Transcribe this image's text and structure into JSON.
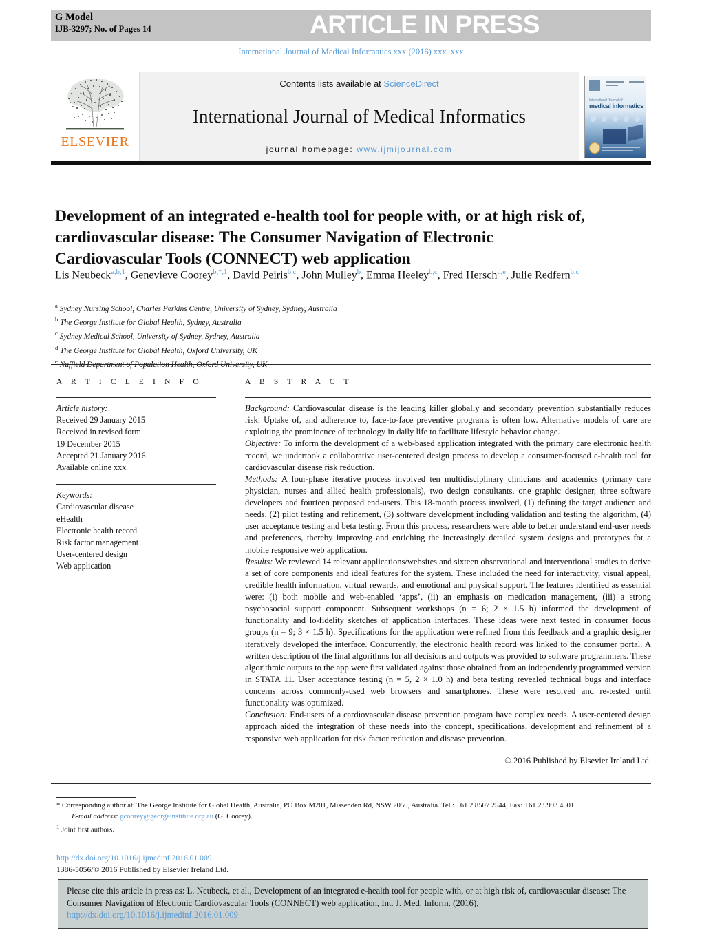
{
  "header": {
    "g_model": "G Model",
    "manuscript_id": "IJB-3297;   No. of Pages 14",
    "article_in_press": "ARTICLE IN PRESS",
    "runhead": "International Journal of Medical Informatics xxx (2016) xxx–xxx"
  },
  "masthead": {
    "publisher": "ELSEVIER",
    "contents_prefix": "Contents lists available at ",
    "contents_link": "ScienceDirect",
    "journal_name": "International Journal of Medical Informatics",
    "homepage_label": "journal homepage: ",
    "homepage_url": "www.ijmijournal.com",
    "cover_title_pre": "International Journal of",
    "cover_title_main": "medical informatics"
  },
  "article": {
    "title": "Development of an integrated e-health tool for people with, or at high risk of, cardiovascular disease: The Consumer Navigation of Electronic Cardiovascular Tools (CONNECT) web application",
    "authors": [
      {
        "name": "Lis Neubeck",
        "marks": "a,b,1",
        "sep": ", "
      },
      {
        "name": "Genevieve Coorey",
        "marks": "b,*,1",
        "sep": ", "
      },
      {
        "name": "David Peiris",
        "marks": "b,c",
        "sep": ", "
      },
      {
        "name": "John Mulley",
        "marks": "b",
        "sep": ", "
      },
      {
        "name": "Emma Heeley",
        "marks": "b,c",
        "sep": ", "
      },
      {
        "name": "Fred Hersch",
        "marks": "d,e",
        "sep": ", "
      },
      {
        "name": "Julie Redfern",
        "marks": "b,c",
        "sep": ""
      }
    ],
    "affiliations": [
      {
        "mark": "a",
        "text": "Sydney Nursing School, Charles Perkins Centre, University of Sydney, Sydney, Australia"
      },
      {
        "mark": "b",
        "text": "The George Institute for Global Health, Sydney, Australia"
      },
      {
        "mark": "c",
        "text": "Sydney Medical School, University of Sydney, Sydney, Australia"
      },
      {
        "mark": "d",
        "text": "The George Institute for Global Health, Oxford University, UK"
      },
      {
        "mark": "e",
        "text": "Nuffield Department of Population Health, Oxford University, UK"
      }
    ]
  },
  "article_info": {
    "heading": "A R T I C L E   I N F O",
    "history_label": "Article history:",
    "history": [
      "Received 29 January 2015",
      "Received in revised form",
      "19 December 2015",
      "Accepted 21 January 2016",
      "Available online xxx"
    ],
    "keywords_label": "Keywords:",
    "keywords": [
      "Cardiovascular disease",
      "eHealth",
      "Electronic health record",
      "Risk factor management",
      "User-centered design",
      "Web application"
    ]
  },
  "abstract": {
    "heading": "A B S T R A C T",
    "sections": [
      {
        "label": "Background:",
        "text": " Cardiovascular disease is the leading killer globally and secondary prevention substantially reduces risk. Uptake of, and adherence to, face-to-face preventive programs is often low. Alternative models of care are exploiting the prominence of technology in daily life to facilitate lifestyle behavior change."
      },
      {
        "label": "Objective:",
        "text": " To inform the development of a web-based application integrated with the primary care electronic health record, we undertook a collaborative user-centered design process to develop a consumer-focused e-health tool for cardiovascular disease risk reduction."
      },
      {
        "label": "Methods:",
        "text": " A four-phase iterative process involved ten multidisciplinary clinicians and academics (primary care physician, nurses and allied health professionals), two design consultants, one graphic designer, three software developers and fourteen proposed end-users. This 18-month process involved, (1) defining the target audience and needs, (2) pilot testing and refinement, (3) software development including validation and testing the algorithm, (4) user acceptance testing and beta testing. From this process, researchers were able to better understand end-user needs and preferences, thereby improving and enriching the increasingly detailed system designs and prototypes for a mobile responsive web application."
      },
      {
        "label": "Results:",
        "text": " We reviewed 14 relevant applications/websites and sixteen observational and interventional studies to derive a set of core components and ideal features for the system. These included the need for interactivity, visual appeal, credible health information, virtual rewards, and emotional and physical support. The features identified as essential were: (i) both mobile and web-enabled ‘apps’, (ii) an emphasis on medication management, (iii) a strong psychosocial support component. Subsequent workshops (n = 6; 2 × 1.5 h) informed the development of functionality and lo-fidelity sketches of application interfaces. These ideas were next tested in consumer focus groups (n = 9; 3 × 1.5 h). Specifications for the application were refined from this feedback and a graphic designer iteratively developed the interface. Concurrently, the electronic health record was linked to the consumer portal. A written description of the final algorithms for all decisions and outputs was provided to software programmers. These algorithmic outputs to the app were first validated against those obtained from an independently programmed version in STATA 11. User acceptance testing (n = 5, 2 × 1.0 h) and beta testing revealed technical bugs and interface concerns across commonly-used web browsers and smartphones. These were resolved and re-tested until functionality was optimized."
      },
      {
        "label": "Conclusion:",
        "text": " End-users of a cardiovascular disease prevention program have complex needs. A user-centered design approach aided the integration of these needs into the concept, specifications, development and refinement of a responsive web application for risk factor reduction and disease prevention."
      }
    ],
    "copyright": "© 2016 Published by Elsevier Ireland Ltd."
  },
  "footnotes": {
    "corresponding_mark": "*",
    "corresponding": " Corresponding author at: The George Institute for Global Health, Australia, PO Box M201, Missenden Rd, NSW 2050, Australia. Tel.: +61 2 8507 2544; Fax: +61 2 9993 4501.",
    "email_label": "E-mail address:",
    "email": "gcoorey@georgeinstitute.org.au",
    "email_owner": " (G. Coorey).",
    "joint_mark": "1",
    "joint": " Joint first authors."
  },
  "doi_block": {
    "doi_url": "http://dx.doi.org/10.1016/j.ijmedinf.2016.01.009",
    "issn_line": "1386-5056/© 2016 Published by Elsevier Ireland Ltd."
  },
  "cite_box": {
    "text": "Please cite this article in press as: L. Neubeck, et al., Development of an integrated e-health tool for people with, or at high risk of, cardiovascular disease: The Consumer Navigation of Electronic Cardiovascular Tools (CONNECT) web application, Int. J. Med. Inform. (2016), ",
    "doi_url": "http://dx.doi.org/10.1016/j.ijmedinf.2016.01.009"
  },
  "colors": {
    "band_gray": "#c3c3c3",
    "link_blue": "#5b9bd5",
    "elsevier_orange": "#E87722",
    "cite_box_bg": "#c8d0d0",
    "masthead_bg": "#f1f1f1"
  }
}
